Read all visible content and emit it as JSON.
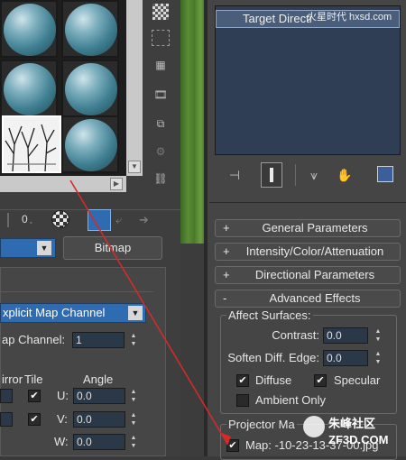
{
  "material_editor": {
    "map_type_button": "Bitmap",
    "mapping_dropdown": "xplicit Map Channel",
    "map_channel": {
      "label": "ap Channel:",
      "value": "1"
    },
    "headers": {
      "mirror": "irror",
      "tile": "Tile",
      "angle": "Angle"
    },
    "angles": [
      {
        "axis": "U:",
        "value": "0.0"
      },
      {
        "axis": "V:",
        "value": "0.0"
      },
      {
        "axis": "W:",
        "value": "0.0"
      }
    ],
    "toolbar_value_label": "0"
  },
  "light_panel": {
    "list_item": "Target Directi",
    "rollouts": [
      {
        "sign": "+",
        "label": "General Parameters"
      },
      {
        "sign": "+",
        "label": "Intensity/Color/Attenuation"
      },
      {
        "sign": "+",
        "label": "Directional Parameters"
      },
      {
        "sign": "-",
        "label": "Advanced Effects"
      }
    ],
    "affect_surfaces": {
      "group_label": "Affect Surfaces:",
      "contrast": {
        "label": "Contrast:",
        "value": "0.0"
      },
      "soften": {
        "label": "Soften Diff. Edge:",
        "value": "0.0"
      },
      "diffuse": "Diffuse",
      "specular": "Specular",
      "ambient_only": "Ambient Only"
    },
    "projector": {
      "group_label": "Projector Ma",
      "map_value": "Map: -10-23-13-37-00.jpg"
    }
  },
  "watermarks": {
    "top_right": "火星时代 hxsd.com",
    "bottom_right": "朱峰社区 ZF3D.COM"
  },
  "colors": {
    "annotation_arrow": "#d42a2a",
    "list_background": "#2f3e55",
    "field_background": "#2a3847",
    "viewport_green": "#4f7d2e"
  }
}
